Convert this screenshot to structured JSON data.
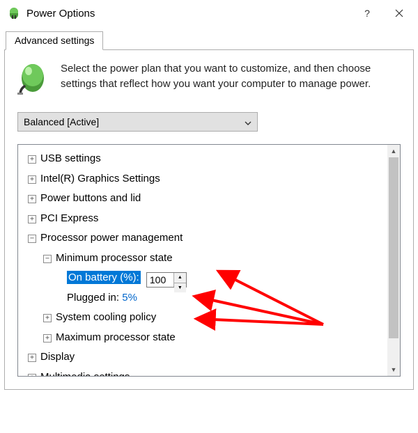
{
  "titlebar": {
    "title": "Power Options",
    "help": "?",
    "close": "×"
  },
  "tab": {
    "label": "Advanced settings"
  },
  "intro": "Select the power plan that you want to customize, and then choose settings that reflect how you want your computer to manage power.",
  "plan": {
    "selected": "Balanced [Active]"
  },
  "tree": {
    "usb": "USB settings",
    "intel_gfx": "Intel(R) Graphics Settings",
    "power_buttons": "Power buttons and lid",
    "pci": "PCI Express",
    "proc_mgmt": "Processor power management",
    "min_proc": "Minimum processor state",
    "on_battery_label": "On battery (%):",
    "on_battery_value": "100",
    "plugged_label": "Plugged in:",
    "plugged_value": "5%",
    "cooling": "System cooling policy",
    "max_proc": "Maximum processor state",
    "display": "Display",
    "multimedia": "Multimedia settings"
  },
  "glyphs": {
    "plus": "+",
    "minus": "−",
    "up": "▲",
    "down": "▼",
    "caret": "⌄"
  }
}
